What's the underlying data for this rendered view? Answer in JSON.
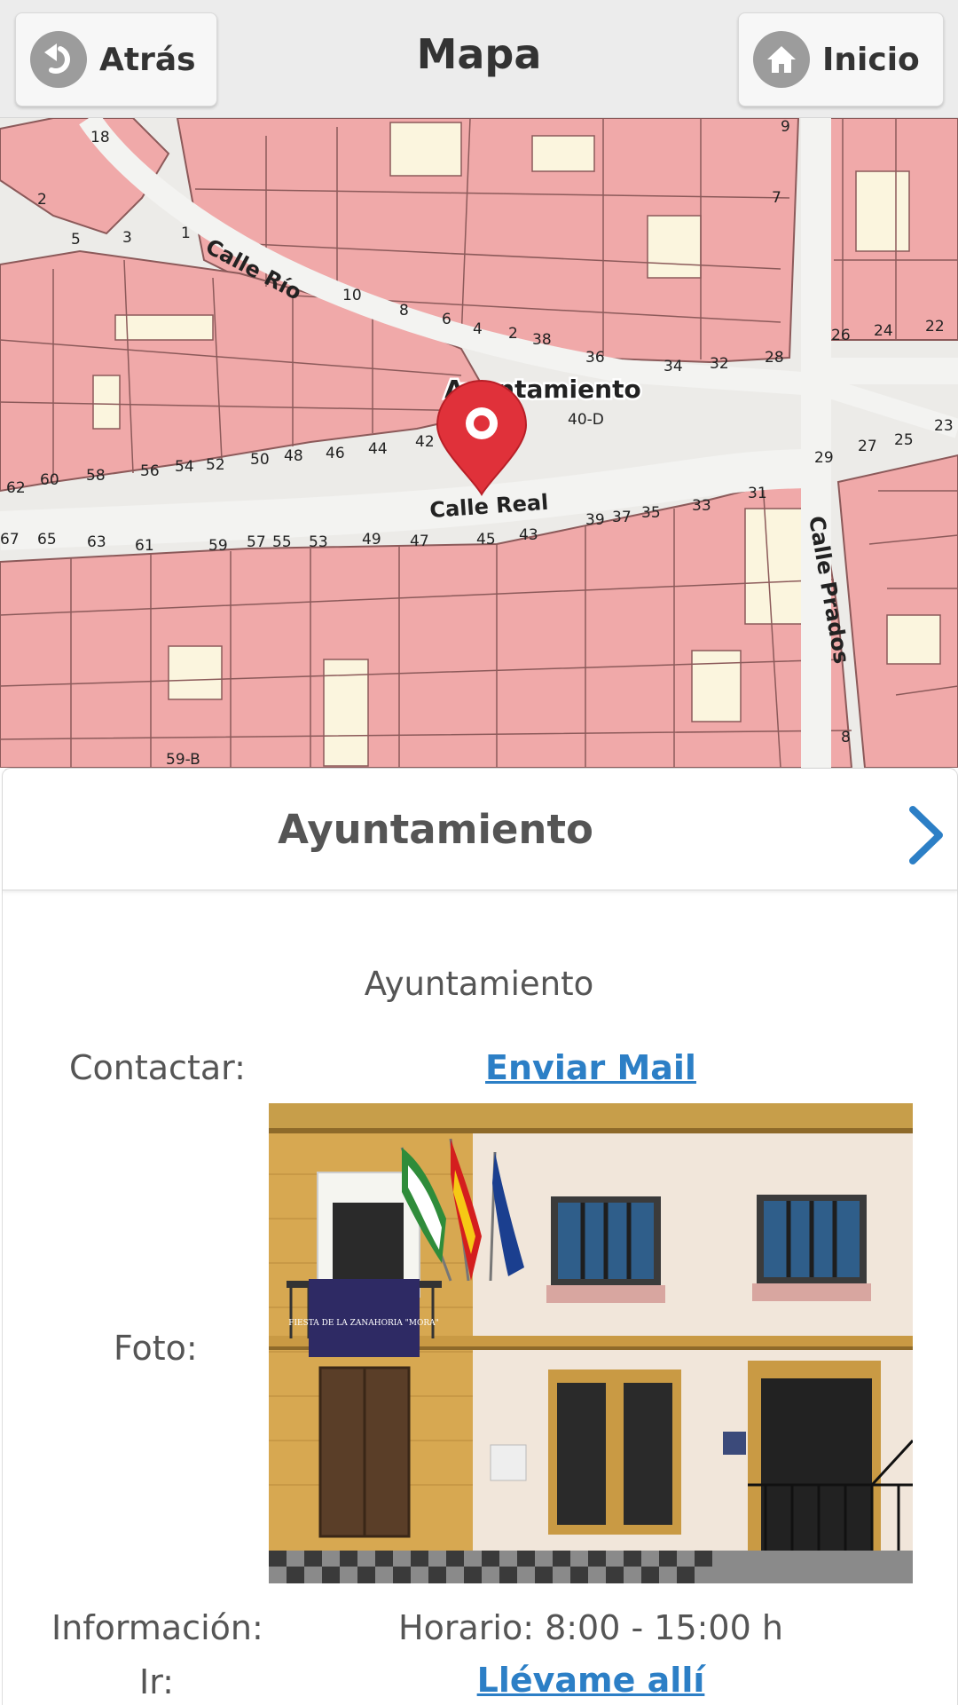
{
  "header": {
    "back_label": "Atrás",
    "back_icon": "back-arrow-icon",
    "title": "Mapa",
    "home_label": "Inicio",
    "home_icon": "home-icon"
  },
  "map": {
    "marker_label": "Ayuntamiento",
    "streets": [
      "Calle Río",
      "Calle Real",
      "Calle Prados"
    ],
    "house_numbers": [
      "18",
      "2",
      "5",
      "3",
      "1",
      "10",
      "8",
      "6",
      "4",
      "2",
      "38",
      "36",
      "34",
      "32",
      "28",
      "9",
      "7",
      "26",
      "24",
      "22",
      "40-D",
      "42",
      "44",
      "46",
      "48",
      "50",
      "52",
      "54",
      "56",
      "58",
      "60",
      "62",
      "29",
      "27",
      "25",
      "23",
      "31",
      "33",
      "35",
      "37",
      "39",
      "43",
      "45",
      "47",
      "49",
      "53",
      "55",
      "57",
      "59",
      "61",
      "63",
      "65",
      "67",
      "59-B",
      "8"
    ],
    "colors": {
      "building": "#f0a9a9",
      "building_edge": "#8c5a5a",
      "yard": "#fbf5de",
      "road": "#f3f3f1",
      "marker": "#e0313a"
    }
  },
  "panel": {
    "title": "Ayuntamiento",
    "chevron_icon": "chevron-right-icon",
    "place_name": "Ayuntamiento",
    "contact_label": "Contactar:",
    "contact_link": "Enviar Mail",
    "photo_label": "Foto:",
    "photo_banner": "FIESTA DE LA ZANAHORIA \"MORA\"",
    "info_label": "Información:",
    "info_value": "Horario: 8:00 - 15:00 h",
    "go_label": "Ir:",
    "go_link": "Llévame allí",
    "link_color": "#2c7fc6"
  }
}
